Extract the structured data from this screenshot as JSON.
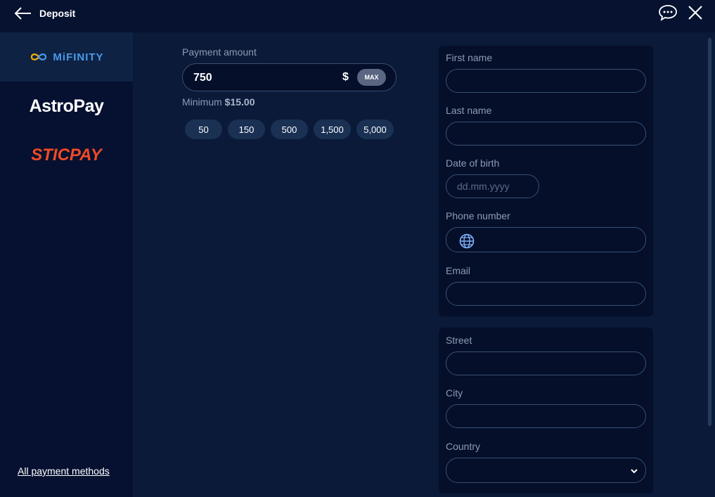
{
  "header": {
    "title": "Deposit",
    "back_icon": "arrow-left-icon",
    "chat_icon": "chat-bubble-icon",
    "close_icon": "close-icon"
  },
  "sidebar": {
    "methods": [
      {
        "name": "MiFINITY",
        "active": true
      },
      {
        "name": "AstroPay",
        "active": false
      },
      {
        "name": "STICPAY",
        "active": false
      }
    ],
    "all_methods_link": "All payment methods"
  },
  "amount": {
    "label": "Payment amount",
    "value": "750",
    "currency": "$",
    "max_label": "MAX",
    "minimum_prefix": "Minimum",
    "minimum_value": "$15.00",
    "quick_amounts": [
      "50",
      "150",
      "500",
      "1,500",
      "5,000"
    ]
  },
  "form": {
    "first_name": {
      "label": "First name",
      "value": ""
    },
    "last_name": {
      "label": "Last name",
      "value": ""
    },
    "dob": {
      "label": "Date of birth",
      "placeholder": "dd.mm.yyyy",
      "value": ""
    },
    "phone": {
      "label": "Phone number",
      "value": "",
      "icon": "globe-icon"
    },
    "email": {
      "label": "Email",
      "value": ""
    },
    "street": {
      "label": "Street",
      "value": ""
    },
    "city": {
      "label": "City",
      "value": ""
    },
    "country": {
      "label": "Country",
      "value": ""
    }
  },
  "colors": {
    "background": "#0a1a38",
    "header": "#061230",
    "sidebar": "#061030",
    "card": "#050f2a",
    "accent_mifinity": "#4a9be8",
    "accent_sticpay": "#ef4a25"
  }
}
